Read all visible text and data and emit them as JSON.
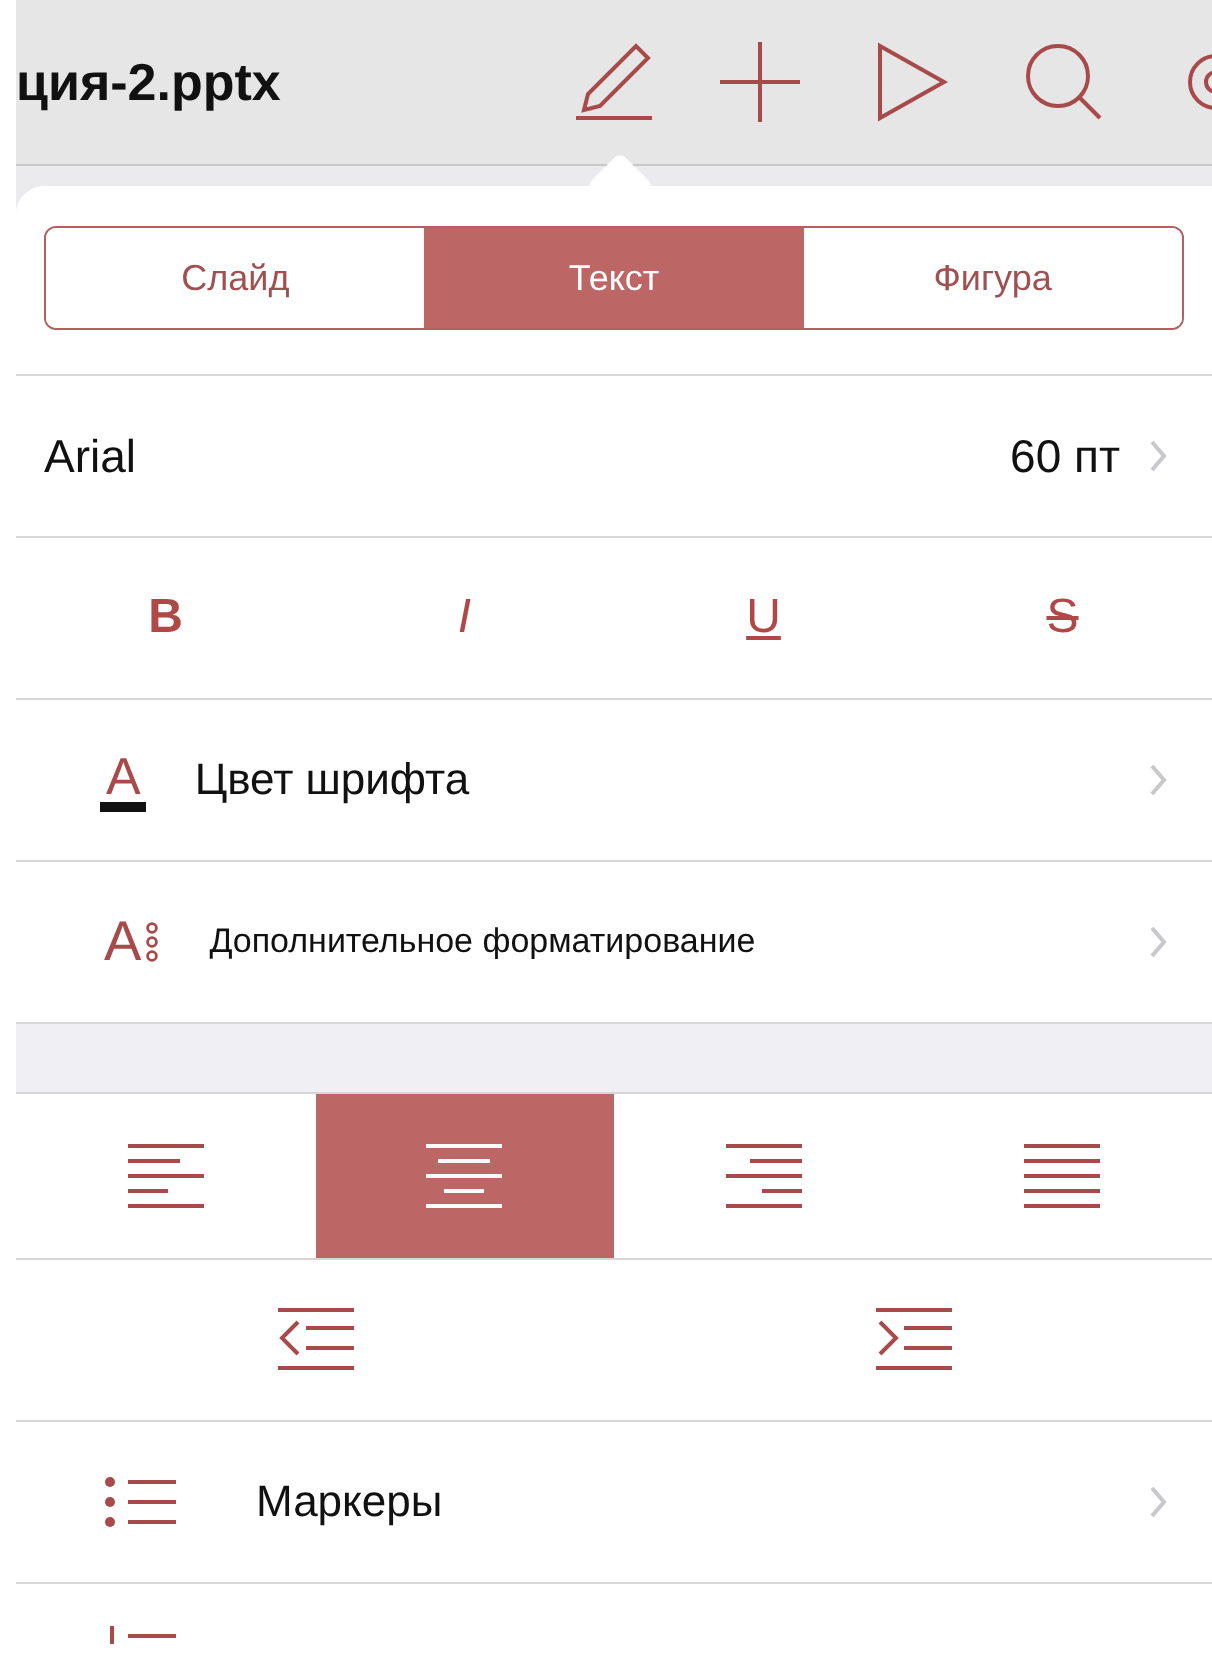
{
  "toolbar": {
    "title": "ция-2.pptx",
    "tools": [
      {
        "kind": "pencil"
      },
      {
        "kind": "plus"
      },
      {
        "kind": "play"
      },
      {
        "kind": "search"
      },
      {
        "kind": "gear"
      }
    ]
  },
  "tabs": [
    {
      "label": "Слайд",
      "selected": false
    },
    {
      "label": "Текст",
      "selected": true
    },
    {
      "label": "Фигура",
      "selected": false
    }
  ],
  "font": {
    "name": "Arial",
    "size": "60 пт"
  },
  "styles": [
    {
      "kind": "bold",
      "label": "B"
    },
    {
      "kind": "italic",
      "label": "I"
    },
    {
      "kind": "underline",
      "label": "U"
    },
    {
      "kind": "strike",
      "label": "S"
    }
  ],
  "menu_items": [
    {
      "kind": "font-color",
      "glyph": "A",
      "label": "Цвет шрифта"
    },
    {
      "kind": "more-format",
      "glyph": "A",
      "label": "Дополнительное форматирование"
    }
  ],
  "alignment": [
    {
      "kind": "left",
      "selected": false
    },
    {
      "kind": "center",
      "selected": true
    },
    {
      "kind": "right",
      "selected": false
    },
    {
      "kind": "justify",
      "selected": false
    }
  ],
  "indent": [
    {
      "kind": "decrease"
    },
    {
      "kind": "increase"
    }
  ],
  "lists": [
    {
      "kind": "bullets",
      "label": "Маркеры"
    },
    {
      "kind": "numbered"
    }
  ]
}
